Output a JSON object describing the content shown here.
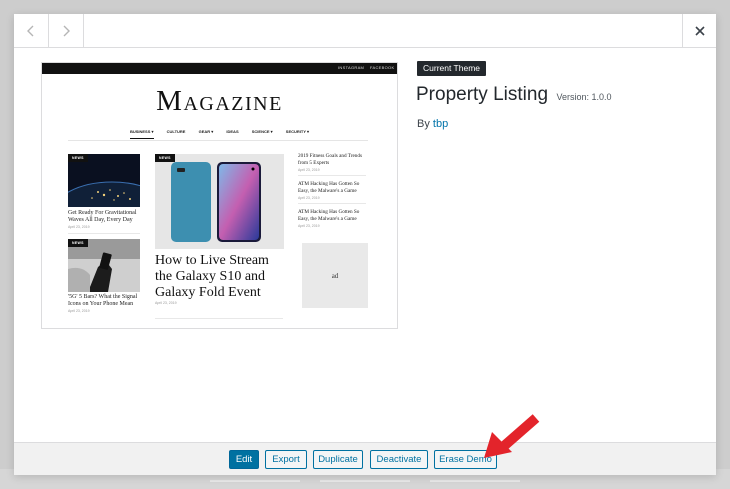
{
  "window": {
    "prev_icon": "chevron-left-icon",
    "next_icon": "chevron-right-icon",
    "close_icon": "close-icon"
  },
  "preview": {
    "topbar_links": [
      "INSTAGRAM",
      "FACEBOOK"
    ],
    "masthead": "Magazine",
    "nav": [
      "BUSINESS ▾",
      "CULTURE",
      "GEAR ▾",
      "IDEAS",
      "SCIENCE ▾",
      "SECURITY ▾"
    ],
    "cards": [
      {
        "badge": "NEWS",
        "title": "Get Ready For Gravitational Waves All Day, Every Day",
        "date": "April 23, 2019"
      },
      {
        "badge": "NEWS",
        "title": "'5G' 5 Bars? What the Signal Icons on Your Phone Mean",
        "date": "April 23, 2019"
      }
    ],
    "feature": {
      "badge": "NEWS",
      "title": "How to Live Stream the Galaxy S10 and Galaxy Fold Event",
      "date": "April 23, 2019"
    },
    "sidebar": [
      {
        "title": "2019 Fitness Goals and Trends from 5 Experts",
        "date": "April 23, 2019"
      },
      {
        "title": "ATM Hacking Has Gotten So Easy, the Malware's a Game",
        "date": "April 23, 2019"
      },
      {
        "title": "ATM Hacking Has Gotten So Easy, the Malware's a Game",
        "date": "April 23, 2019"
      }
    ],
    "ad_label": "ad"
  },
  "theme": {
    "badge": "Current Theme",
    "name": "Property Listing",
    "version": "Version: 1.0.0",
    "author_prefix": "By",
    "author": "tbp"
  },
  "actions": {
    "edit": "Edit",
    "export": "Export",
    "duplicate": "Duplicate",
    "deactivate": "Deactivate",
    "erase_demo": "Erase Demo"
  },
  "colors": {
    "accent": "#0071a1",
    "badge_bg": "#23282d",
    "arrow": "#e3242b"
  }
}
